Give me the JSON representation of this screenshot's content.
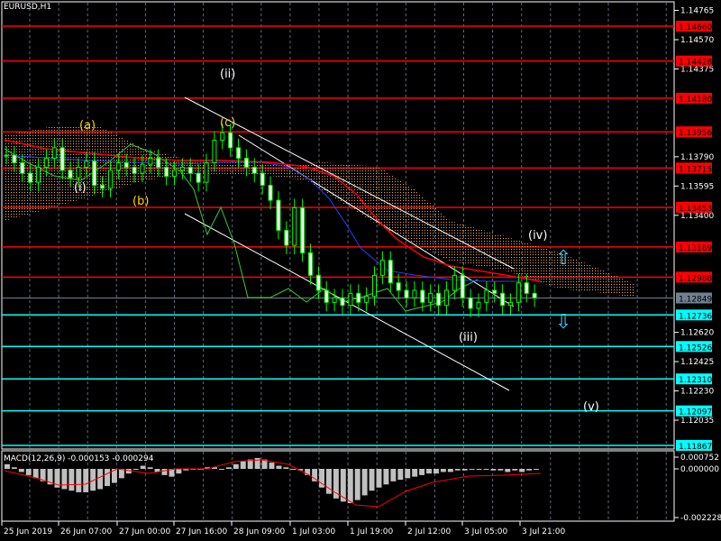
{
  "symbol": "EURUSD,H1",
  "macd_label": "MACD(12,26,9) -0.000153 -0.000294",
  "price_axis": [
    "1.14765",
    "1.14570",
    "1.14375",
    "1.13790",
    "1.13595",
    "1.13400",
    "1.12620",
    "1.12425",
    "1.12230",
    "1.12035"
  ],
  "macd_axis": [
    "0.000752",
    "0.000000",
    "-0.002228"
  ],
  "red_levels": [
    "1.14660",
    "1.14428",
    "1.14180",
    "1.13956",
    "1.13715",
    "1.13453",
    "1.13189",
    "1.12988"
  ],
  "cyan_levels": [
    "1.12736",
    "1.12526",
    "1.12310",
    "1.12097",
    "1.11867"
  ],
  "current_price": "1.12849",
  "time_axis": [
    "25 Jun 2019",
    "26 Jun 07:00",
    "27 Jun 00:00",
    "27 Jun 16:00",
    "28 Jun 09:00",
    "1 Jul 03:00",
    "1 Jul 19:00",
    "2 Jul 12:00",
    "3 Jul 05:00",
    "3 Jul 21:00"
  ],
  "waves": {
    "i": "(i)",
    "a": "(a)",
    "b": "(b)",
    "ii": "(ii)",
    "c": "(c)",
    "iii": "(iii)",
    "iv": "(iv)",
    "v": "(v)"
  },
  "colors": {
    "red_level": "#ff0000",
    "cyan_level": "#00ffff",
    "current": "#708090",
    "up_arrow": "#33ccff"
  },
  "chart_data": {
    "type": "candlestick",
    "closes": [
      1.138,
      1.1375,
      1.1368,
      1.1362,
      1.1372,
      1.1378,
      1.1385,
      1.137,
      1.1365,
      1.1372,
      1.1376,
      1.136,
      1.1358,
      1.137,
      1.1375,
      1.1372,
      1.1368,
      1.1374,
      1.1378,
      1.1372,
      1.1366,
      1.137,
      1.1372,
      1.1368,
      1.1362,
      1.1375,
      1.139,
      1.1395,
      1.1385,
      1.1378,
      1.1372,
      1.1368,
      1.136,
      1.135,
      1.133,
      1.132,
      1.1345,
      1.1315,
      1.13,
      1.129,
      1.1282,
      1.1285,
      1.128,
      1.1288,
      1.1282,
      1.1286,
      1.13,
      1.131,
      1.1295,
      1.129,
      1.1285,
      1.129,
      1.1282,
      1.1288,
      1.128,
      1.129,
      1.13,
      1.1285,
      1.1278,
      1.1282,
      1.129,
      1.1288,
      1.128,
      1.1282,
      1.1295,
      1.1288,
      1.1285
    ],
    "macd_hist": [
      0.0003,
      0.0001,
      -0.0002,
      -0.0004,
      -0.0006,
      -0.0008,
      -0.001,
      -0.0012,
      -0.0013,
      -0.0014,
      -0.0015,
      -0.0015,
      -0.0014,
      -0.0013,
      -0.0011,
      -0.0009,
      -0.0006,
      -0.0003,
      0.0,
      0.0002,
      0.0001,
      -0.0002,
      -0.0004,
      -0.0005,
      -0.0003,
      -0.0001,
      0.0,
      0.0,
      0.0001,
      0.0001,
      0.0,
      0.0001,
      0.0003,
      0.0005,
      0.0006,
      0.0007,
      0.0006,
      0.0004,
      0.0002,
      0.0001,
      0.0,
      -0.0001,
      -0.0004,
      -0.0008,
      -0.0012,
      -0.0016,
      -0.0019,
      -0.0021,
      -0.0022,
      -0.002,
      -0.0017,
      -0.0014,
      -0.0012,
      -0.001,
      -0.0008,
      -0.0007,
      -0.0006,
      -0.0005,
      -0.0004,
      -0.0003,
      -0.0003,
      -0.0002,
      -0.0002,
      -0.0001,
      -0.0001,
      0.0,
      0.0,
      0.0,
      -0.0001,
      -0.0001,
      -0.0002,
      -0.0001,
      -0.0002,
      -0.0001,
      0.0
    ]
  }
}
